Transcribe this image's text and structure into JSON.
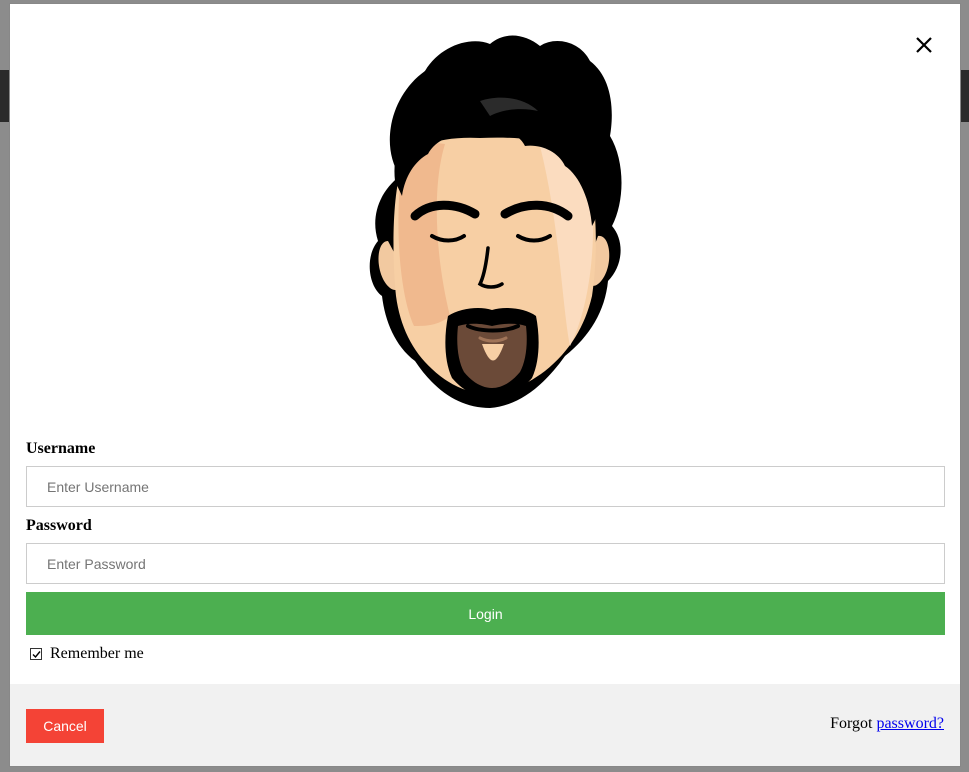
{
  "login_modal": {
    "close_icon": "close-icon",
    "avatar_icon": "avatar-icon",
    "username": {
      "label": "Username",
      "placeholder": "Enter Username",
      "value": ""
    },
    "password": {
      "label": "Password",
      "placeholder": "Enter Password",
      "value": ""
    },
    "login_label": "Login",
    "remember_me": {
      "label": "Remember me",
      "checked": true
    },
    "footer": {
      "cancel_label": "Cancel",
      "forgot_prefix": "Forgot",
      "forgot_link": "password?"
    }
  },
  "colors": {
    "login_button": "#4caf50",
    "cancel_button": "#f44336",
    "footer_background": "#f1f1f1",
    "link": "#0000ee"
  }
}
